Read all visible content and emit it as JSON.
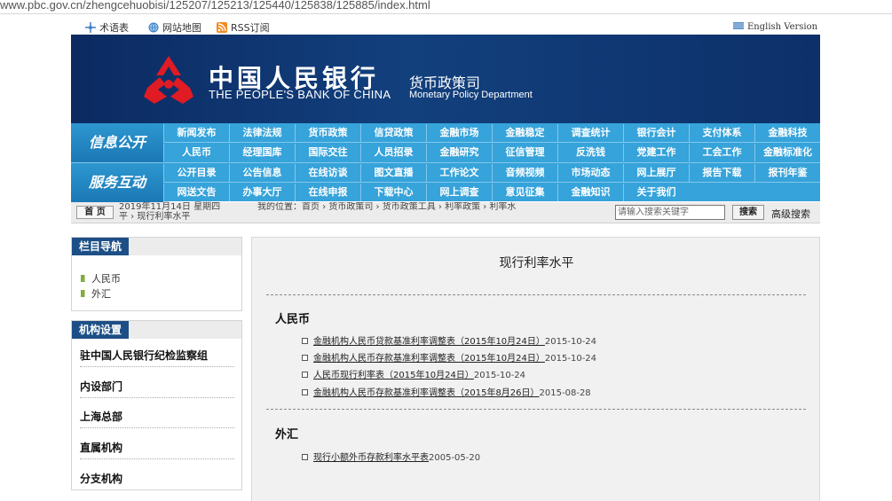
{
  "browser": {
    "url": "www.pbc.gov.cn/zhengcehuobisi/125207/125213/125440/125838/125885/index.html"
  },
  "utility_bar": {
    "glossary": "术语表",
    "sitemap": "网站地图",
    "rss": "RSS订阅",
    "english": "English Version"
  },
  "banner": {
    "name_cn": "中国人民银行",
    "name_en": "THE PEOPLE'S BANK OF CHINA",
    "dept_cn": "货币政策司",
    "dept_en": "Monetary Policy Department"
  },
  "nav": {
    "info_label": "信息公开",
    "service_label": "服务互动",
    "info_row1": [
      "新闻发布",
      "法律法规",
      "货币政策",
      "信贷政策",
      "金融市场",
      "金融稳定",
      "调查统计",
      "银行会计",
      "支付体系",
      "金融科技"
    ],
    "info_row2": [
      "人民币",
      "经理国库",
      "国际交往",
      "人员招录",
      "金融研究",
      "征信管理",
      "反洗钱",
      "党建工作",
      "工会工作",
      "金融标准化"
    ],
    "service_row1": [
      "公开目录",
      "公告信息",
      "在线访谈",
      "图文直播",
      "工作论文",
      "音频视频",
      "市场动态",
      "网上展厅",
      "报告下载",
      "报刊年鉴"
    ],
    "service_row2": [
      "网送文告",
      "办事大厅",
      "在线申报",
      "下载中心",
      "网上调查",
      "意见征集",
      "金融知识",
      "关于我们"
    ]
  },
  "breadcrumb": {
    "home_button": "首 页",
    "date": "2019年11月14日  星期四",
    "location": "我的位置：首页   ›   货币政策司   ›   货币政策工具   ›   利率政策   ›   利率水",
    "location_tail": "平   ›   现行利率水平",
    "search_placeholder": "请输入搜索关键字",
    "search_button": "搜索",
    "advanced_search": "高级搜索"
  },
  "sidebar": {
    "nav_title": "栏目导航",
    "nav_items": [
      "人民币",
      "外汇"
    ],
    "org_title": "机构设置",
    "org_items": [
      "驻中国人民银行纪检监察组",
      "内设部门",
      "上海总部",
      "直属机构",
      "分支机构"
    ]
  },
  "main": {
    "title": "现行利率水平",
    "rmb_heading": "人民币",
    "rmb_items": [
      {
        "text": "金融机构人民币贷款基准利率调整表（2015年10月24日）",
        "date": "2015-10-24"
      },
      {
        "text": "金融机构人民币存款基准利率调整表（2015年10月24日）",
        "date": "2015-10-24"
      },
      {
        "text": "人民币现行利率表（2015年10月24日）",
        "date": "2015-10-24"
      },
      {
        "text": "金融机构人民币存款基准利率调整表（2015年8月26日）",
        "date": "2015-08-28"
      }
    ],
    "fx_heading": "外汇",
    "fx_items": [
      {
        "text": "现行小额外币存款利率水平表",
        "date": "2005-05-20"
      }
    ]
  },
  "colors": {
    "banner_bg": "#12407d",
    "nav_bg": "#36a3da",
    "sidebar_tab": "#1d4f86"
  }
}
